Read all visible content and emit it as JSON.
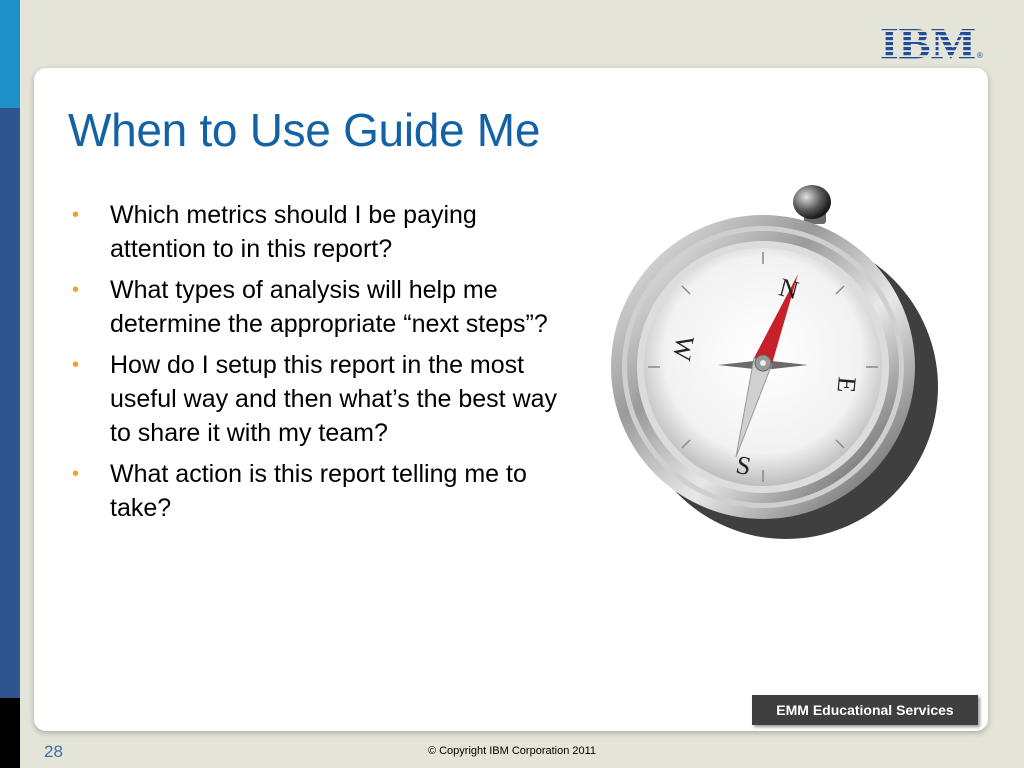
{
  "slide": {
    "title": "When to Use Guide Me",
    "bullets": [
      "Which metrics should I be paying attention to in this report?",
      "What types of analysis will help me determine the appropriate “next steps”?",
      "How do I setup this report in the most useful way and then what’s the best way to share it with my team?",
      "What action is this report telling me to take?"
    ],
    "bullet_glyph": "•"
  },
  "branding": {
    "logo_text": "IBM",
    "logo_color": "#1f4d9a",
    "badge": "EMM Educational Services"
  },
  "footer": {
    "page_number": "28",
    "copyright": "© Copyright IBM Corporation 2011"
  },
  "compass": {
    "labels": {
      "n": "N",
      "e": "E",
      "s": "S",
      "w": "W"
    }
  },
  "colors": {
    "title": "#1462a6",
    "bullet": "#f0a030",
    "background": "#e5e4d8"
  }
}
